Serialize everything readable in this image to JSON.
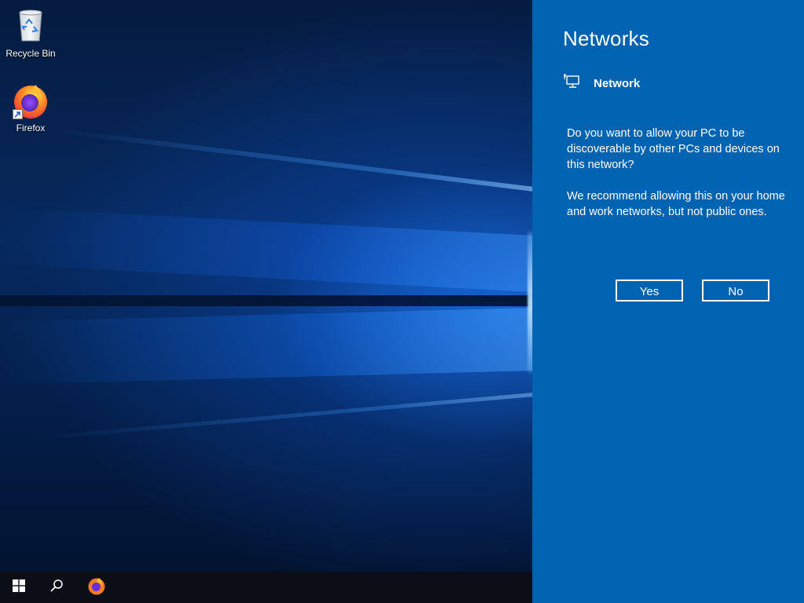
{
  "desktop": {
    "icons": [
      {
        "label": "Recycle Bin",
        "icon": "recycle-bin-icon"
      },
      {
        "label": "Firefox",
        "icon": "firefox-icon"
      }
    ]
  },
  "taskbar": {
    "start_icon": "windows-logo-icon",
    "search_icon": "search-icon",
    "pinned_app_icon": "firefox-icon"
  },
  "networks_panel": {
    "title": "Networks",
    "network_name": "Network",
    "network_icon": "wired-network-icon",
    "question": "Do you want to allow your PC to be discoverable by other PCs and devices on this network?",
    "recommendation": "We recommend allowing this on your home and work networks, but not public ones.",
    "yes_label": "Yes",
    "no_label": "No",
    "background_color": "#0063b1"
  }
}
